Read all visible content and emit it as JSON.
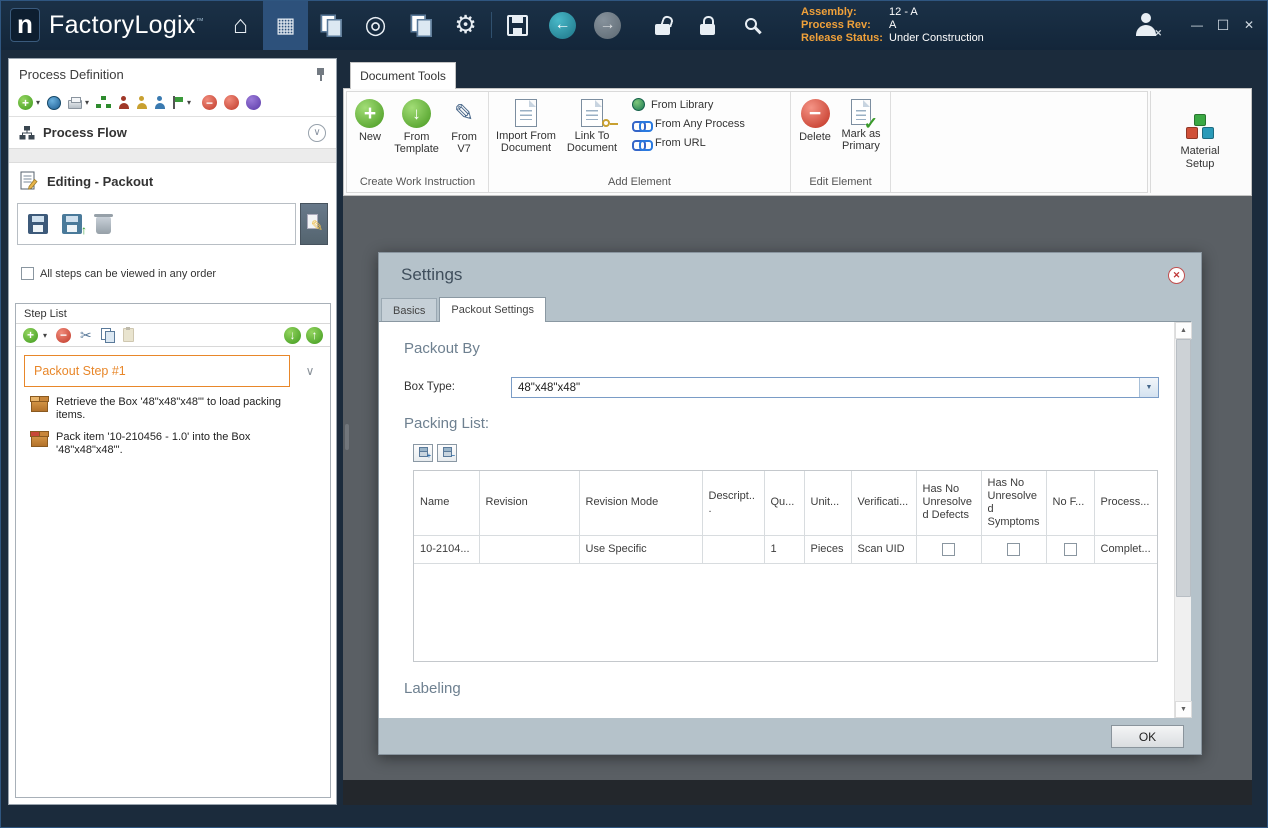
{
  "colors": {
    "accent_orange": "#e8872a",
    "titlebar_navy": "#16293d",
    "dialog_chrome": "#b5c2ca",
    "active_tool_blue": "#2d517b",
    "status_label_orange": "#f0a13a"
  },
  "icons": {
    "home": "⌂",
    "process_grid": "▦",
    "disc": "◎",
    "gear": "⚙",
    "back_arrow": "←",
    "forward_arrow": "→",
    "caret_down": "▾",
    "chevron_down": "∨",
    "cut": "✂",
    "plus": "+",
    "minus": "−",
    "arrow_up": "↑",
    "arrow_down": "↓",
    "check": "✓",
    "pencil": "✎",
    "close_x": "✕",
    "dropdown_arrow": "▼",
    "scroll_up": "▲",
    "scroll_down": "▼"
  },
  "titlebar": {
    "logo_letter": "n",
    "app_name": "FactoryLogix",
    "trademark": "™",
    "info_rows": [
      {
        "label": "Assembly:",
        "value": "12 - A"
      },
      {
        "label": "Process Rev:",
        "value": "A"
      },
      {
        "label": "Release Status:",
        "value": "Under Construction"
      }
    ]
  },
  "window_controls": {
    "minimize": "—",
    "maximize": "☐",
    "close": "✕"
  },
  "left_panel": {
    "title": "Process Definition",
    "process_flow_label": "Process Flow",
    "editing_label": "Editing - Packout",
    "order_checkbox": "All steps can be viewed in any order",
    "step_list_title": "Step List",
    "selected_step": "Packout Step #1",
    "step_items": [
      "Retrieve the Box '48\"x48\"x48\"' to load packing items.",
      "Pack item '10-210456 - 1.0' into the Box '48\"x48\"x48\"'."
    ]
  },
  "ribbon": {
    "tab_label": "Document Tools",
    "create_group": {
      "label": "Create Work Instruction",
      "new": "New",
      "from_template": "From Template",
      "from_v7": "From V7"
    },
    "add_group": {
      "label": "Add Element",
      "import_from_document": "Import From Document",
      "link_to_document": "Link To Document",
      "from_library": "From Library",
      "from_any_process": "From Any Process",
      "from_url": "From URL"
    },
    "edit_group": {
      "label": "Edit Element",
      "delete": "Delete",
      "mark_as_primary": "Mark as Primary"
    },
    "material_setup_line1": "Material",
    "material_setup_line2": "Setup"
  },
  "dialog": {
    "title": "Settings",
    "tab_basics": "Basics",
    "tab_packout": "Packout Settings",
    "packout_by_heading": "Packout By",
    "box_type_label": "Box Type:",
    "box_type_value": "48\"x48\"x48\"",
    "packing_list_heading": "Packing List:",
    "columns": [
      "Name",
      "Revision",
      "Revision Mode",
      "Descript...",
      "Qu...",
      "Unit...",
      "Verificati...",
      "Has No Unresolved Defects",
      "Has No Unresolved Symptoms",
      "No F...",
      "Process..."
    ],
    "row": {
      "name": "10-2104...",
      "revision": "",
      "revision_mode": "Use Specific",
      "description": "",
      "quantity": "1",
      "unit": "Pieces",
      "verification": "Scan UID",
      "no_f": "",
      "process": "Complet..."
    },
    "labeling_heading": "Labeling",
    "ok_label": "OK"
  }
}
